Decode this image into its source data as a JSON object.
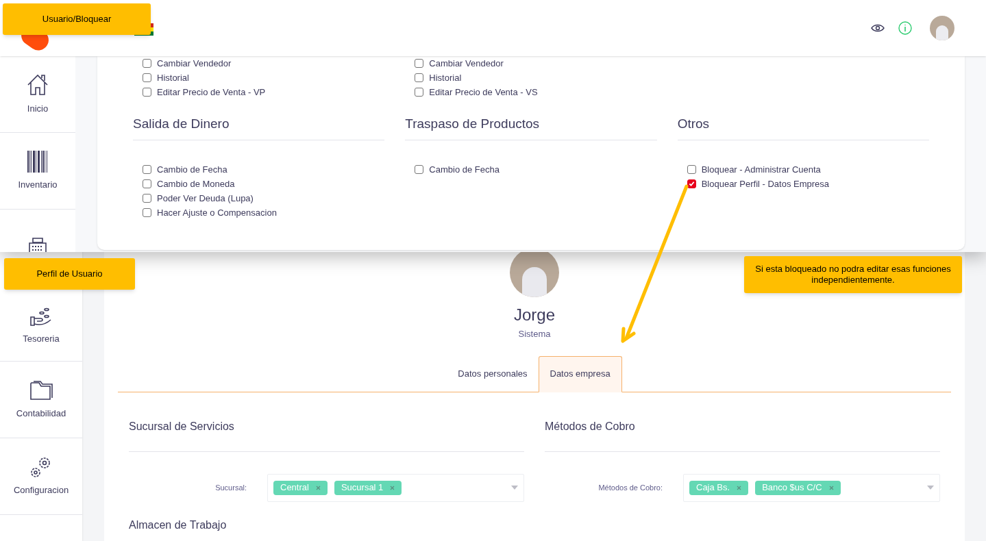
{
  "notes": [
    {
      "text": "Usuario/Bloquear"
    },
    {
      "text": "Perfil de Usuario"
    },
    {
      "text": "Si esta bloqueado no podra editar esas funciones independientemente."
    }
  ],
  "sidebar_top": [
    {
      "kind": "home",
      "label": "Inicio"
    },
    {
      "kind": "barcode",
      "label": "Inventario"
    },
    {
      "kind": "register"
    }
  ],
  "sidebar_bottom": [
    {
      "kind": "coins",
      "label": "Tesoreria"
    },
    {
      "kind": "folder",
      "label": "Contabilidad"
    },
    {
      "kind": "gears",
      "label": "Configuracion"
    }
  ],
  "permissions": {
    "top_columns": [
      [
        {
          "label": "Cambiar Vendedor",
          "checked": false
        },
        {
          "label": "Historial",
          "checked": false
        },
        {
          "label": "Editar Precio de Venta - VP",
          "checked": false
        }
      ],
      [
        {
          "label": "Cambiar Vendedor",
          "checked": false
        },
        {
          "label": "Historial",
          "checked": false
        },
        {
          "label": "Editar Precio de Venta - VS",
          "checked": false
        }
      ],
      []
    ],
    "sections": [
      {
        "title": "Salida de Dinero",
        "items": [
          {
            "label": "Cambio de Fecha",
            "checked": false
          },
          {
            "label": "Cambio de Moneda",
            "checked": false
          },
          {
            "label": "Poder Ver Deuda (Lupa)",
            "checked": false
          },
          {
            "label": "Hacer Ajuste o Compensacion",
            "checked": false
          }
        ]
      },
      {
        "title": "Traspaso de Productos",
        "items": [
          {
            "label": "Cambio de Fecha",
            "checked": false
          }
        ]
      },
      {
        "title": "Otros",
        "items": [
          {
            "label": "Bloquear - Administrar Cuenta",
            "checked": false
          },
          {
            "label": "Bloquear Perfil - Datos Empresa",
            "checked": true
          }
        ]
      }
    ]
  },
  "profile": {
    "name": "Jorge",
    "role": "Sistema",
    "tabs": [
      {
        "label": "Datos personales",
        "selected": false
      },
      {
        "label": "Datos empresa",
        "selected": true
      }
    ],
    "sections": [
      {
        "title": "Sucursal de Servicios",
        "field_label": "Sucursal:",
        "tags": [
          "Central",
          "Sucursal 1"
        ]
      },
      {
        "title": "Métodos de Cobro",
        "field_label": "Métodos de Cobro:",
        "tags": [
          "Caja Bs.",
          "Banco $us C/C"
        ]
      }
    ],
    "next_section_title": "Almacen de Trabajo"
  }
}
